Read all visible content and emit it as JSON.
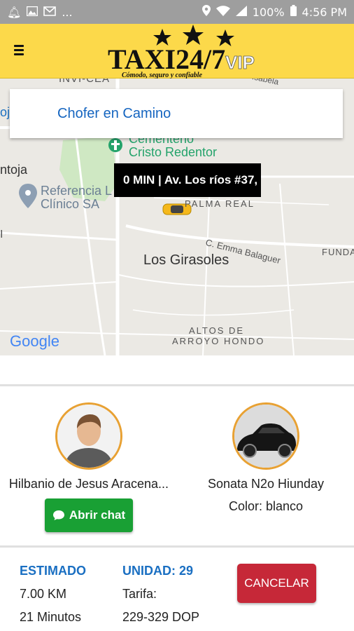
{
  "statusbar": {
    "left_icons": [
      "notification-bell-icon",
      "image-icon",
      "gmail-icon"
    ],
    "ellipsis": "...",
    "battery_percent": "100%",
    "time": "4:56 PM"
  },
  "header": {
    "logo_text": "TAXI24/7",
    "logo_vip": "VIP",
    "logo_tagline": "Cómodo, seguro y confiable",
    "colors": {
      "bar": "#fcd94a"
    }
  },
  "map": {
    "labels": {
      "invi_cea": "INVI-CEA",
      "cementerio_1": "Cementerio",
      "cementerio_2": "Cristo Redentor",
      "ntoja": "ntoja",
      "referencia_1": "Referencia L",
      "referencia_2": "Clínico SA",
      "palma_real": "PALMA REAL",
      "emma": "C. Emma Balaguer",
      "los_girasoles": "Los Girasoles",
      "funda": "FUNDA",
      "altos_1": "ALTOS DE",
      "altos_2": "ARROYO HONDO",
      "google": "Google",
      "left_i": "I",
      "left_oj": "oj",
      "isabela": "Isabela"
    }
  },
  "status_card": {
    "text": "Chofer en Camino"
  },
  "eta_tooltip": {
    "text": "0 MIN | Av. Los ríos #37,"
  },
  "driver": {
    "name": "Hilbanio de Jesus Aracena...",
    "chat_button": "Abrir chat"
  },
  "vehicle": {
    "model": "Sonata N2o Hiunday",
    "color": "Color: blanco"
  },
  "trip": {
    "estimated_title": "ESTIMADO",
    "distance": "7.00 KM",
    "duration": "21 Minutos",
    "unit_title": "UNIDAD: 29",
    "fare_label": "Tarifa:",
    "fare_value": "229-329 DOP"
  },
  "actions": {
    "cancel": "CANCELAR"
  }
}
